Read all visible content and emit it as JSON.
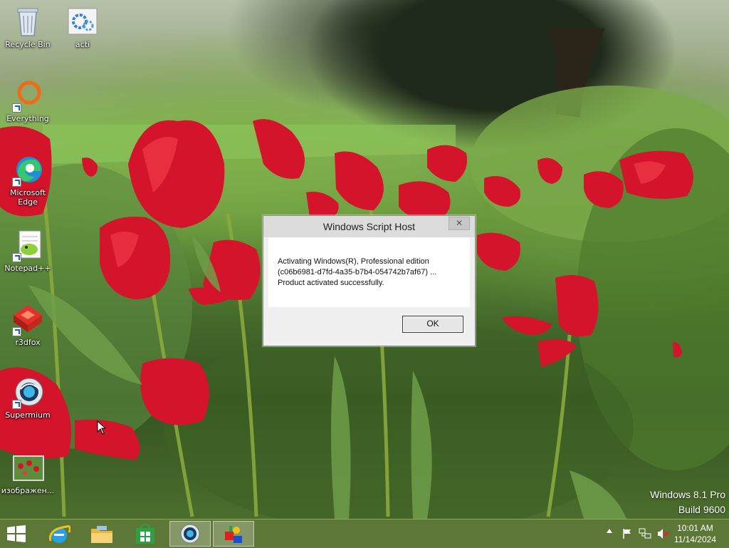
{
  "desktop": {
    "icons": [
      {
        "label": "Recycle Bin",
        "icon": "recycle-bin-icon"
      },
      {
        "label": "acti",
        "icon": "script-gear-icon"
      },
      {
        "label": "Everything",
        "icon": "everything-search-icon"
      },
      {
        "label": "Microsoft Edge",
        "icon": "edge-icon"
      },
      {
        "label": "Notepad++",
        "icon": "notepad-plus-plus-icon"
      },
      {
        "label": "r3dfox",
        "icon": "r3dfox-icon"
      },
      {
        "label": "Supermium",
        "icon": "supermium-icon"
      },
      {
        "label": "изображен...",
        "icon": "image-file-icon"
      }
    ]
  },
  "dialog": {
    "title": "Windows Script Host",
    "close_label": "✕",
    "message_line1": "Activating Windows(R), Professional edition",
    "message_line2": "(c06b6981-d7fd-4a35-b7b4-054742b7af67) ...",
    "message_line3": "Product activated successfully.",
    "ok_label": "OK"
  },
  "watermark": {
    "line1": "Windows 8.1 Pro",
    "line2": "Build 9600"
  },
  "taskbar": {
    "items": [
      {
        "icon": "start-icon"
      },
      {
        "icon": "internet-explorer-icon"
      },
      {
        "icon": "file-explorer-icon"
      },
      {
        "icon": "store-icon"
      },
      {
        "icon": "supermium-icon",
        "active": true
      },
      {
        "icon": "script-host-icon",
        "active": true
      }
    ],
    "tray": [
      "show-hidden-icons-icon",
      "action-center-flag-icon",
      "network-icon",
      "volume-muted-icon"
    ],
    "time": "10:01 AM",
    "date": "11/14/2024"
  },
  "colors": {
    "taskbar": "#5c7634",
    "dialog_bg": "#f0f0f0",
    "tulip_red": "#d3142a"
  }
}
